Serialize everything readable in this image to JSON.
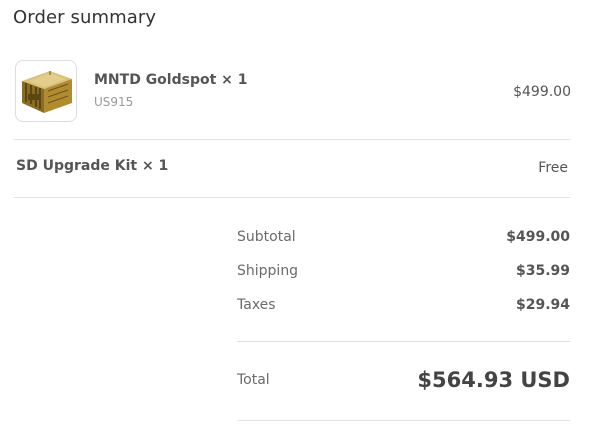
{
  "header": {
    "title": "Order summary"
  },
  "line_items": [
    {
      "name": "MNTD Goldspot × 1",
      "sku": "US915",
      "price": "$499.00",
      "image_icon": "gold-device-box-icon"
    }
  ],
  "addons": [
    {
      "name": "SD Upgrade Kit × 1",
      "price": "Free"
    }
  ],
  "totals": {
    "subtotal_label": "Subtotal",
    "subtotal_value": "$499.00",
    "shipping_label": "Shipping",
    "shipping_value": "$35.99",
    "taxes_label": "Taxes",
    "taxes_value": "$29.94",
    "total_label": "Total",
    "total_value": "$564.93 USD"
  },
  "colors": {
    "text_primary": "#333333",
    "text_secondary": "#6b6b6b",
    "divider": "#e3e3e3",
    "product_gold": "#b8952e"
  }
}
